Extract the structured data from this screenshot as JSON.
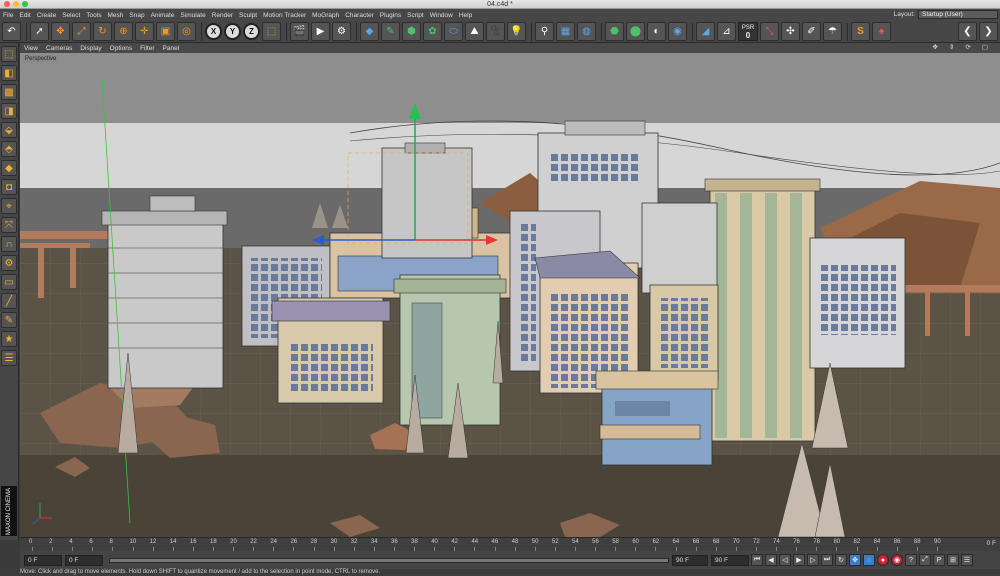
{
  "window": {
    "title": "04.c4d *"
  },
  "menu": [
    "File",
    "Edit",
    "Create",
    "Select",
    "Tools",
    "Mesh",
    "Snap",
    "Animate",
    "Simulate",
    "Render",
    "Sculpt",
    "Motion Tracker",
    "MoGraph",
    "Character",
    "Plugins",
    "Script",
    "Window",
    "Help"
  ],
  "layout": {
    "label": "Layout:",
    "value": "Startup (User)"
  },
  "toolbar": {
    "axis_x": "X",
    "axis_y": "Y",
    "axis_z": "Z",
    "psr_label": "PSR",
    "psr_value": "0"
  },
  "viewport": {
    "menu": [
      "View",
      "Cameras",
      "Display",
      "Options",
      "Filter",
      "Panel"
    ],
    "label": "Perspective"
  },
  "timeline": {
    "ticks": [
      "0",
      "2",
      "4",
      "6",
      "8",
      "10",
      "12",
      "14",
      "16",
      "18",
      "20",
      "22",
      "24",
      "26",
      "28",
      "30",
      "32",
      "34",
      "36",
      "38",
      "40",
      "42",
      "44",
      "46",
      "48",
      "50",
      "52",
      "54",
      "56",
      "58",
      "60",
      "62",
      "64",
      "66",
      "68",
      "70",
      "72",
      "74",
      "76",
      "78",
      "80",
      "82",
      "84",
      "86",
      "88",
      "90"
    ],
    "current": "0 F"
  },
  "playback": {
    "start": "0 F",
    "current": "0 F",
    "end_inner": "90 F",
    "end": "90 F"
  },
  "status": "Move: Click and drag to move elements. Hold down SHIFT to quantize movement / add to the selection in point mode, CTRL to remove.",
  "colors": {
    "accent": "#f09a28",
    "ground": "#5e5a52",
    "sky": "#d8d8d8",
    "selection": "#e0b040"
  }
}
